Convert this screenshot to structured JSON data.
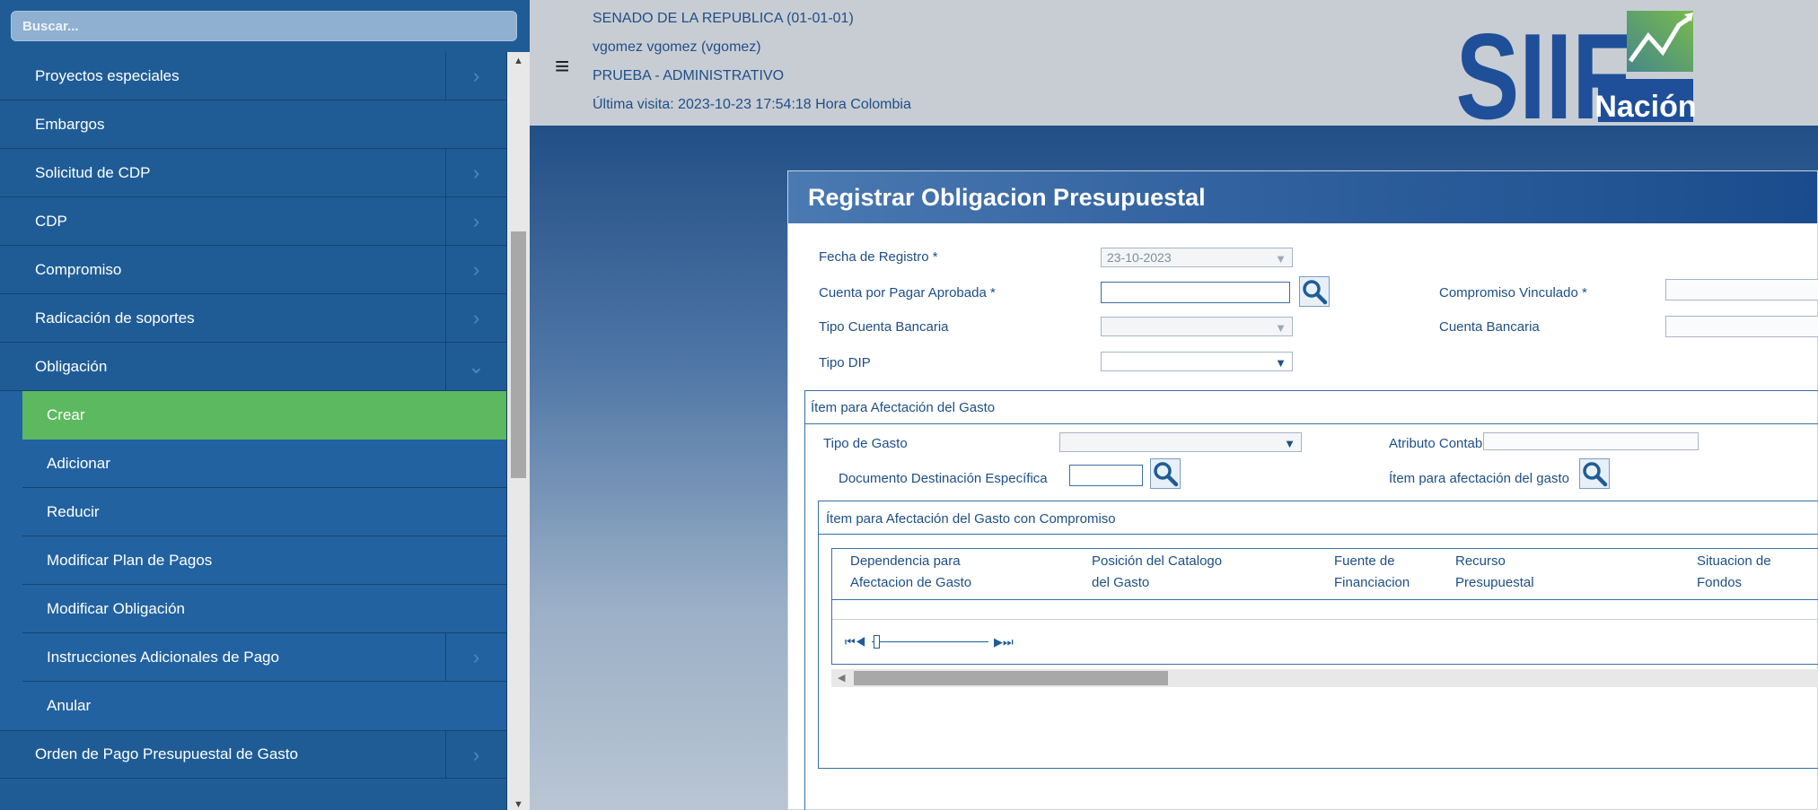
{
  "sidebar": {
    "search_placeholder": "Buscar...",
    "items": [
      {
        "label": "Proyectos especiales"
      },
      {
        "label": "Embargos"
      },
      {
        "label": "Solicitud de CDP"
      },
      {
        "label": "CDP"
      },
      {
        "label": "Compromiso"
      },
      {
        "label": "Radicación de soportes"
      },
      {
        "label": "Obligación"
      }
    ],
    "sub_items": [
      {
        "label": "Crear"
      },
      {
        "label": "Adicionar"
      },
      {
        "label": "Reducir"
      },
      {
        "label": "Modificar Plan de Pagos"
      },
      {
        "label": "Modificar Obligación"
      },
      {
        "label": "Instrucciones Adicionales de Pago"
      },
      {
        "label": "Anular"
      }
    ],
    "after_items": [
      {
        "label": "Orden de Pago Presupuestal de Gasto"
      }
    ],
    "chevron_right": "›",
    "chevron_down": "⌄"
  },
  "header": {
    "entity": "SENADO DE LA REPUBLICA (01-01-01)",
    "user": "vgomez vgomez (vgomez)",
    "environment": "PRUEBA - ADMINISTRATIVO",
    "last_visit": "Última visita: 2023-10-23 17:54:18 Hora Colombia",
    "logo_text": "SIIF",
    "logo_sub": "Nación"
  },
  "form": {
    "title": "Registrar Obligacion Presupuestal",
    "fecha_registro_label": "Fecha de Registro *",
    "fecha_registro_value": "23-10-2023",
    "cuenta_pagar_label": "Cuenta por Pagar Aprobada *",
    "compromiso_label": "Compromiso Vinculado *",
    "tipo_cuenta_label": "Tipo Cuenta Bancaria",
    "cuenta_bancaria_label": "Cuenta Bancaria",
    "tipo_dip_label": "Tipo DIP",
    "section_item": "Ítem para Afectación del Gasto",
    "tipo_gasto_label": "Tipo de Gasto",
    "atributo_label": "Atributo Contable",
    "doc_destinacion_label": "Documento Destinación Específica",
    "item_afectacion_label": "Ítem para afectación del gasto",
    "section_compromiso": "Ítem para Afectación del Gasto con Compromiso",
    "columns": [
      {
        "l1": "Dependencia para",
        "l2": "Afectacion de Gasto"
      },
      {
        "l1": "Posición del Catalogo",
        "l2": "del Gasto"
      },
      {
        "l1": "Fuente de",
        "l2": "Financiacion"
      },
      {
        "l1": "Recurso",
        "l2": "Presupuestal"
      },
      {
        "l1": "Situacion de",
        "l2": "Fondos"
      }
    ]
  }
}
